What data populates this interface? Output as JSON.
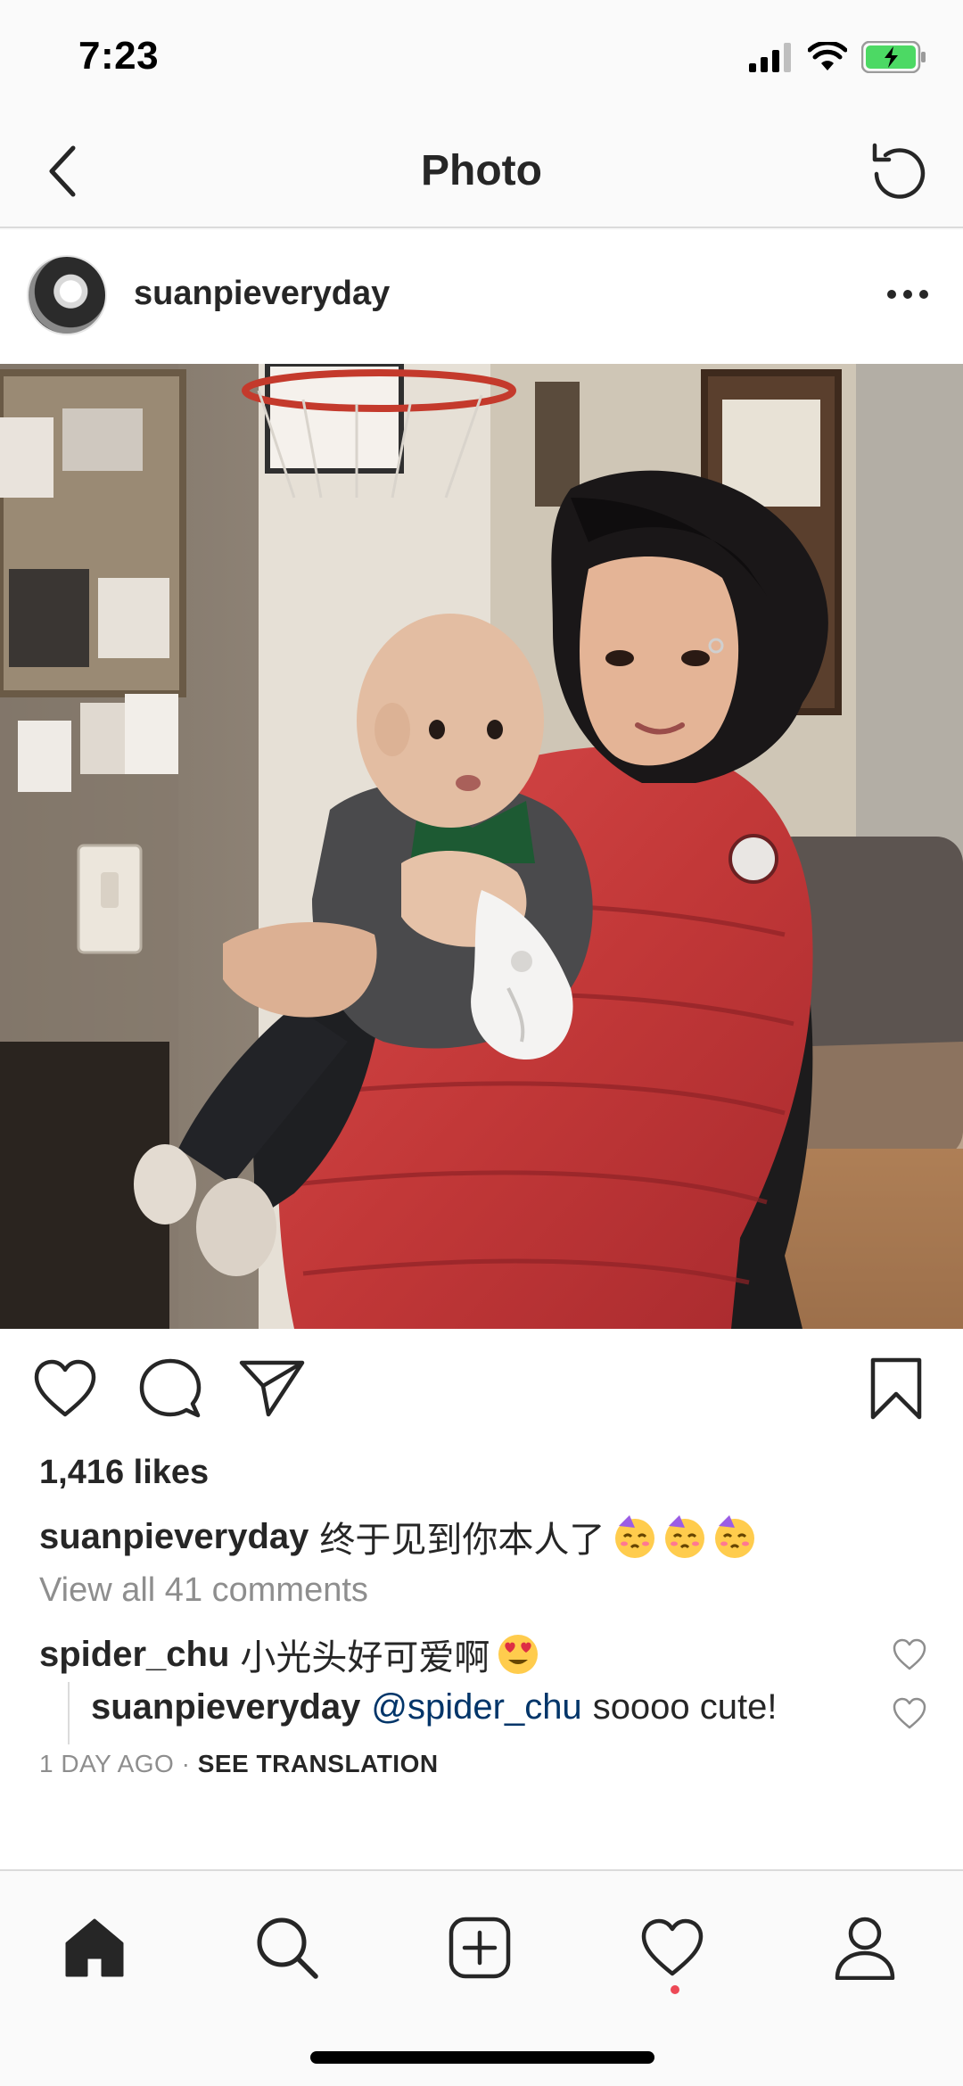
{
  "status_bar": {
    "time": "7:23"
  },
  "nav": {
    "title": "Photo",
    "back_icon": "chevron-left-icon",
    "refresh_icon": "refresh-icon"
  },
  "post": {
    "username": "suanpieveryday",
    "more_icon": "more-horizontal-icon",
    "photo_alt": "Woman in red puffer jacket holding a baby",
    "likes": "1,416 likes",
    "caption": {
      "username": "suanpieveryday",
      "text": "终于见到你本人了"
    },
    "view_comments": "View all 41 comments",
    "comments": [
      {
        "username": "spider_chu",
        "text": "小光头好可爱啊"
      }
    ],
    "reply": {
      "username": "suanpieveryday",
      "mention": "@spider_chu",
      "text": "soooo cute!"
    },
    "timestamp": "1 DAY AGO",
    "separator": "·",
    "see_translation": "SEE TRANSLATION"
  },
  "colors": {
    "text": "#262626",
    "secondary": "#8e8e8e",
    "mention": "#003569",
    "notification": "#ed4956",
    "battery": "#4cd964"
  }
}
